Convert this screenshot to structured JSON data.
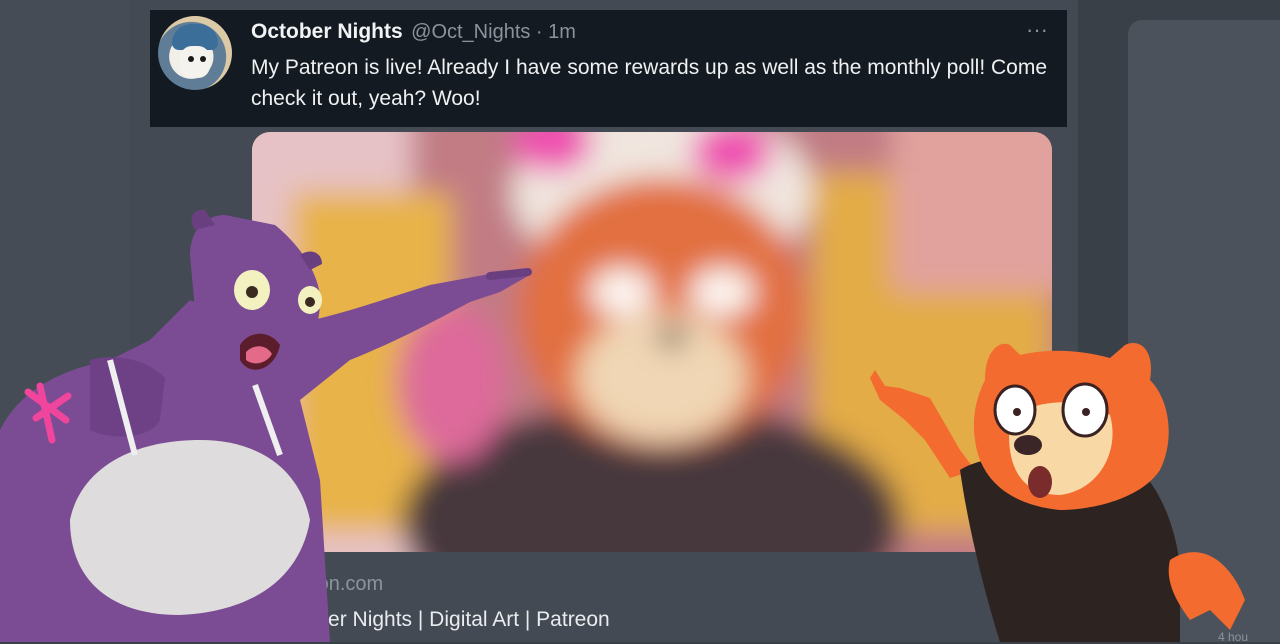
{
  "tweet": {
    "display_name": "October Nights",
    "handle_time": "@Oct_Nights · 1m",
    "more_label": "···",
    "text": "My Patreon is live! Already I have some rewards up as well as the monthly poll! Come check it out, yeah? Woo!"
  },
  "link_card": {
    "domain": "patreon.com",
    "title": "October Nights | Digital Art | Patreon"
  },
  "corner_text": "4 hou",
  "colors": {
    "tweet_background": "#141a21",
    "page_background": "#434a53",
    "accent_blue": "#3d9be0"
  },
  "icons": [
    "more-options-icon"
  ]
}
